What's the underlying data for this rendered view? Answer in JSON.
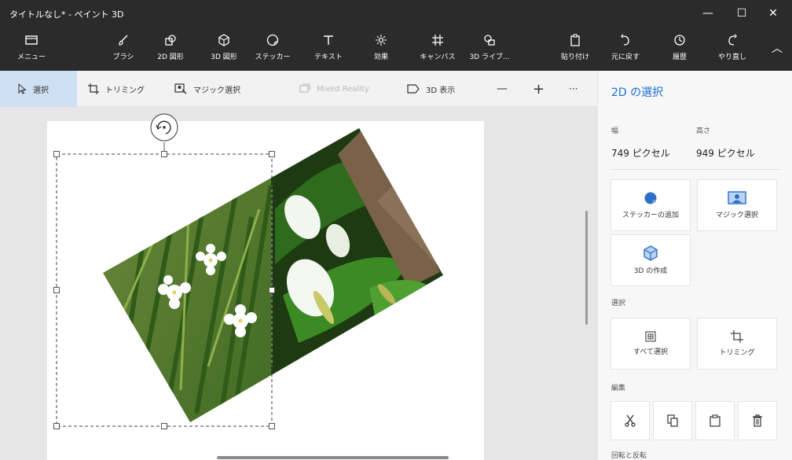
{
  "window": {
    "title": "タイトルなし* - ペイント 3D",
    "minimize_glyph": "—",
    "maximize_glyph": "☐",
    "close_glyph": "✕"
  },
  "toolbar": {
    "items": [
      {
        "label": "メニュー",
        "icon": "menu-folder-icon"
      },
      {
        "label": "ブラシ",
        "icon": "brush-icon"
      },
      {
        "label": "2D 図形",
        "icon": "2d-shapes-icon"
      },
      {
        "label": "3D 図形",
        "icon": "3d-shapes-icon"
      },
      {
        "label": "ステッカー",
        "icon": "stickers-icon"
      },
      {
        "label": "テキスト",
        "icon": "text-icon"
      },
      {
        "label": "効果",
        "icon": "effects-icon"
      },
      {
        "label": "キャンバス",
        "icon": "canvas-icon"
      },
      {
        "label": "3D ライブ...",
        "icon": "3d-library-icon"
      },
      {
        "label": "貼り付け",
        "icon": "paste-icon"
      },
      {
        "label": "元に戻す",
        "icon": "undo-icon"
      },
      {
        "label": "履歴",
        "icon": "history-icon"
      },
      {
        "label": "やり直し",
        "icon": "redo-icon"
      }
    ],
    "collapse_glyph": "︿"
  },
  "cmdbar": {
    "select": "選択",
    "crop": "トリミング",
    "magic_select": "マジック選択",
    "mixed_reality": "Mixed Reality",
    "view_3d": "3D 表示",
    "zoom_out": "—",
    "zoom_in": "+",
    "more": "···"
  },
  "panel": {
    "title": "2D の選択",
    "width_label": "幅",
    "width_value": "749 ピクセル",
    "height_label": "高さ",
    "height_value": "949 ピクセル",
    "add_sticker": "ステッカーの追加",
    "magic_select": "マジック選択",
    "make_3d": "3D の作成",
    "section_select": "選択",
    "select_all": "すべて選択",
    "crop": "トリミング",
    "section_edit": "編集",
    "section_rotate": "回転と反転"
  },
  "colors": {
    "accent": "#1a6fd0",
    "toolbar_bg": "#2b2b2b",
    "active_cmd_bg": "#cfe0f4"
  }
}
